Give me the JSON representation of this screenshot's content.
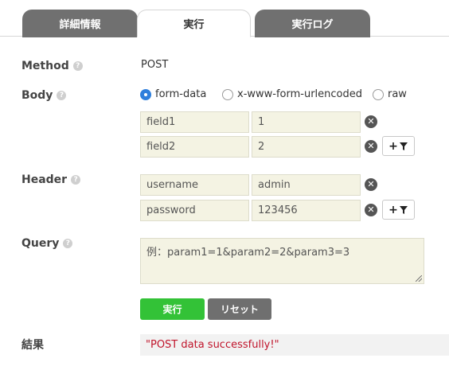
{
  "tabs": [
    {
      "label": "詳細情報",
      "active": false
    },
    {
      "label": "実行",
      "active": true
    },
    {
      "label": "実行ログ",
      "active": false
    }
  ],
  "method": {
    "label": "Method",
    "value": "POST"
  },
  "body": {
    "label": "Body",
    "options": [
      "form-data",
      "x-www-form-urlencoded",
      "raw"
    ],
    "selected": "form-data",
    "rows": [
      {
        "key": "field1",
        "value": "1"
      },
      {
        "key": "field2",
        "value": "2"
      }
    ]
  },
  "header": {
    "label": "Header",
    "rows": [
      {
        "key": "username",
        "value": "admin"
      },
      {
        "key": "password",
        "value": "123456"
      }
    ]
  },
  "query": {
    "label": "Query",
    "placeholder": "例：param1=1&param2=2&param3=3"
  },
  "help_glyph": "?",
  "remove_glyph": "✕",
  "add_glyph": "+",
  "buttons": {
    "run": "実行",
    "reset": "リセット"
  },
  "result": {
    "label": "結果",
    "value": "\"POST data successfully!\""
  },
  "colors": {
    "run": "#33c237",
    "reset": "#6f6f6f",
    "tab_inactive": "#707070",
    "result_text": "#c0142b",
    "radio_selected": "#2f7fdc"
  }
}
